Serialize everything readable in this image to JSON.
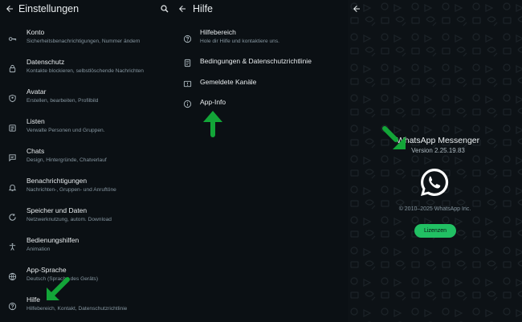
{
  "settings": {
    "title": "Einstellungen",
    "items": [
      {
        "label": "Konto",
        "sub": "Sicherheitsbenachrichtigungen, Nummer ändern",
        "icon": "key-icon"
      },
      {
        "label": "Datenschutz",
        "sub": "Kontakte blockieren, selbstlöschende Nachrichten",
        "icon": "lock-icon"
      },
      {
        "label": "Avatar",
        "sub": "Erstellen, bearbeiten, Profilbild",
        "icon": "avatar-icon"
      },
      {
        "label": "Listen",
        "sub": "Verwalte Personen und Gruppen.",
        "icon": "list-icon"
      },
      {
        "label": "Chats",
        "sub": "Design, Hintergründe, Chatverlauf",
        "icon": "chat-icon"
      },
      {
        "label": "Benachrichtigungen",
        "sub": "Nachrichten-, Gruppen- und Anruftöne",
        "icon": "bell-icon"
      },
      {
        "label": "Speicher und Daten",
        "sub": "Netzwerknutzung, autom. Download",
        "icon": "data-icon"
      },
      {
        "label": "Bedienungshilfen",
        "sub": "Animation",
        "icon": "accessibility-icon"
      },
      {
        "label": "App-Sprache",
        "sub": "Deutsch (Sprache des Geräts)",
        "icon": "globe-icon"
      },
      {
        "label": "Hilfe",
        "sub": "Hilfebereich, Kontakt, Datenschutzrichtlinie",
        "icon": "help-icon"
      }
    ]
  },
  "help": {
    "title": "Hilfe",
    "items": [
      {
        "label": "Hilfebereich",
        "sub": "Hole dir Hilfe und kontaktiere uns.",
        "icon": "help-icon"
      },
      {
        "label": "Bedingungen & Datenschutzrichtlinie",
        "sub": "",
        "icon": "document-icon"
      },
      {
        "label": "Gemeldete Kanäle",
        "sub": "",
        "icon": "flag-icon"
      },
      {
        "label": "App-Info",
        "sub": "",
        "icon": "info-icon"
      }
    ]
  },
  "about": {
    "app_name": "WhatsApp Messenger",
    "version": "Version 2.25.19.83",
    "copyright": "© 2010–2025 WhatsApp Inc.",
    "license_button": "Lizenzen"
  },
  "colors": {
    "background": "#0b1014",
    "text": "#e9edef",
    "subtext": "#8696a0",
    "accent": "#21c063",
    "annotation_arrow": "#13a538"
  }
}
